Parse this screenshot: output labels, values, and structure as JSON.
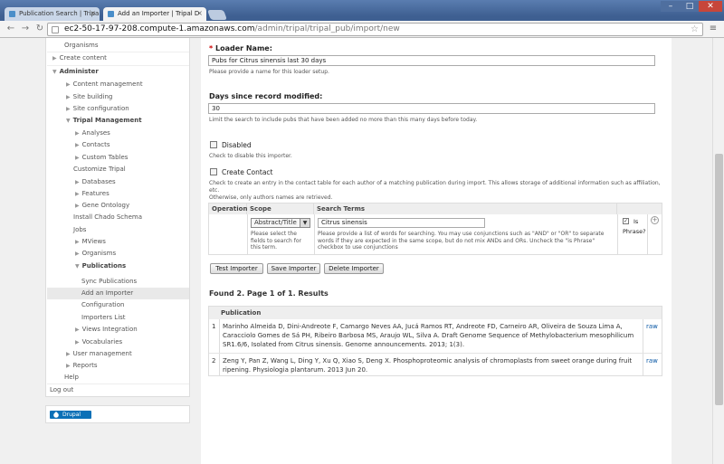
{
  "browser": {
    "tabs": [
      {
        "title": "Publication Search | Tripa"
      },
      {
        "title": "Add an Importer | Tripal D"
      }
    ],
    "url_host": "ec2-50-17-97-208.compute-1.amazonaws.com",
    "url_path": "/admin/tripal/tripal_pub/import/new"
  },
  "sidebar": {
    "items": [
      {
        "label": "Organisms"
      },
      {
        "label": "Create content"
      },
      {
        "label": "Administer"
      },
      {
        "label": "Content management"
      },
      {
        "label": "Site building"
      },
      {
        "label": "Site configuration"
      },
      {
        "label": "Tripal Management"
      },
      {
        "label": "Analyses"
      },
      {
        "label": "Contacts"
      },
      {
        "label": "Custom Tables"
      },
      {
        "label": "Customize Tripal"
      },
      {
        "label": "Databases"
      },
      {
        "label": "Features"
      },
      {
        "label": "Gene Ontology"
      },
      {
        "label": "Install Chado Schema"
      },
      {
        "label": "Jobs"
      },
      {
        "label": "MViews"
      },
      {
        "label": "Organisms"
      },
      {
        "label": "Publications"
      },
      {
        "label": "Sync Publications"
      },
      {
        "label": "Add an Importer"
      },
      {
        "label": "Configuration"
      },
      {
        "label": "Importers List"
      },
      {
        "label": "Views Integration"
      },
      {
        "label": "Vocabularies"
      },
      {
        "label": "User management"
      },
      {
        "label": "Reports"
      },
      {
        "label": "Help"
      },
      {
        "label": "Log out"
      }
    ],
    "badge": "Drupal"
  },
  "form": {
    "loader_name_label": "Loader Name:",
    "required_mark": "*",
    "loader_name_value": "Pubs for Citrus sinensis last 30 days",
    "loader_name_desc": "Please provide a name for this loader setup.",
    "days_label": "Days since record modified:",
    "days_value": "30",
    "days_desc": "Limit the search to include pubs that have been added no more than this many days before today.",
    "disabled_label": "Disabled",
    "disabled_desc": "Check to disable this importer.",
    "create_contact_label": "Create Contact",
    "create_contact_desc_1": "Check to create an entry in the contact table for each author of a matching publication during import. This allows storage of additional information such as affiliation, etc.",
    "create_contact_desc_2": "Otherwise, only authors names are retrieved."
  },
  "criteria": {
    "headers": [
      "Operation",
      "Scope",
      "Search Terms"
    ],
    "scope_value": "Abstract/Title",
    "scope_desc": "Please select the fields to search for this term.",
    "term_value": "Citrus sinensis",
    "term_desc": "Please provide a list of words for searching. You may use conjunctions such as \"AND\" or \"OR\" to separate words if they are expected in the same scope, but do not mix ANDs and ORs. Uncheck the \"is Phrase\" checkbox to use conjunctions",
    "is_label": "Is",
    "phrase_label": "Phrase?"
  },
  "buttons": {
    "test": "Test Importer",
    "save": "Save Importer",
    "delete": "Delete Importer"
  },
  "results": {
    "summary": "Found 2. Page 1 of 1. Results",
    "header": "Publication",
    "rows": [
      {
        "num": "1",
        "text": "Marinho Almeida D, Dini-Andreote F, Camargo Neves AA, Jucá Ramos RT, Andreote FD, Carneiro AR, Oliveira de Souza Lima A, Caracciolo Gomes de Sá PH, Ribeiro Barbosa MS, Araujo WL, Silva A. Draft Genome Sequence of Methylobacterium mesophilicum SR1.6/6, Isolated from Citrus sinensis. Genome announcements. 2013; 1(3).",
        "link": "raw"
      },
      {
        "num": "2",
        "text": "Zeng Y, Pan Z, Wang L, Ding Y, Xu Q, Xiao S, Deng X. Phosphoproteomic analysis of chromoplasts from sweet orange during fruit ripening. Physiologia plantarum. 2013 Jun 20.",
        "link": "raw"
      }
    ]
  }
}
